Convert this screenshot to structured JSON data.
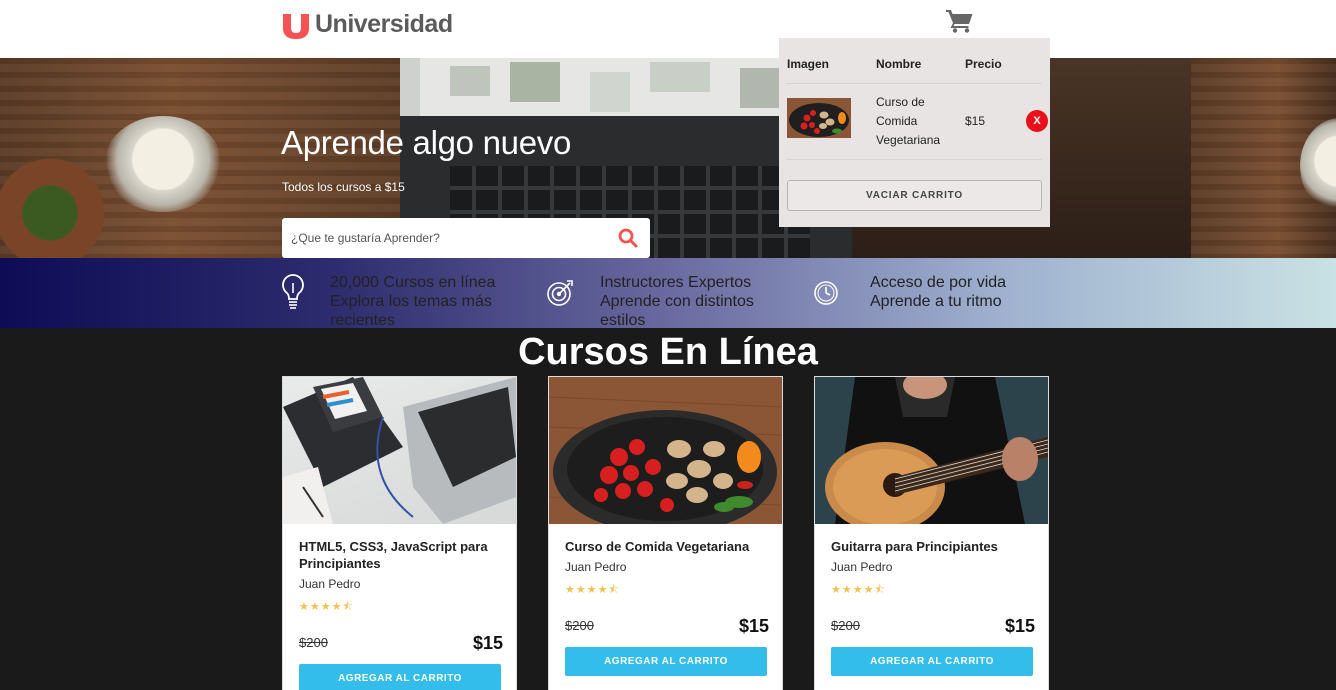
{
  "brand": {
    "name": "Universidad",
    "mark": "u",
    "color": "#f55353"
  },
  "header": {
    "cart_icon": "cart-icon"
  },
  "hero": {
    "title": "Aprende algo nuevo",
    "subtitle": "Todos los cursos a $15",
    "search_placeholder": "¿Que te gustaría Aprender?",
    "search_icon": "search-icon"
  },
  "features": [
    {
      "icon": "lightbulb-icon",
      "line1": "20,000 Cursos en línea",
      "line2": "Explora los temas más recientes"
    },
    {
      "icon": "target-icon",
      "line1": "Instructores Expertos",
      "line2": "Aprende con distintos estilos"
    },
    {
      "icon": "clock-icon",
      "line1": "Acceso de por vida",
      "line2": "Aprende a tu ritmo"
    }
  ],
  "section_title": "Cursos En Línea",
  "courses": [
    {
      "image": "laptop-html-css-photo",
      "title": "HTML5, CSS3, JavaScript para Principiantes",
      "author": "Juan Pedro",
      "rating": 4.5,
      "old_price": "$200",
      "price": "$15",
      "button": "AGREGAR AL CARRITO"
    },
    {
      "image": "vegetable-pan-photo",
      "title": "Curso de Comida Vegetariana",
      "author": "Juan Pedro",
      "rating": 4.5,
      "old_price": "$200",
      "price": "$15",
      "button": "AGREGAR AL CARRITO"
    },
    {
      "image": "guitar-player-photo",
      "title": "Guitarra para Principiantes",
      "author": "Juan Pedro",
      "rating": 4.5,
      "old_price": "$200",
      "price": "$15",
      "button": "AGREGAR AL CARRITO"
    }
  ],
  "cart": {
    "headers": {
      "image": "Imagen",
      "name": "Nombre",
      "price": "Precio"
    },
    "items": [
      {
        "image": "vegetable-pan-photo",
        "name": "Curso de Comida Vegetariana",
        "price": "$15",
        "remove": "X"
      }
    ],
    "empty_button": "VACIAR CARRITO"
  },
  "colors": {
    "accent": "#33bdea",
    "remove": "#e8101a",
    "stars": "#f4c150",
    "dark_bg": "#1a1a1a"
  }
}
